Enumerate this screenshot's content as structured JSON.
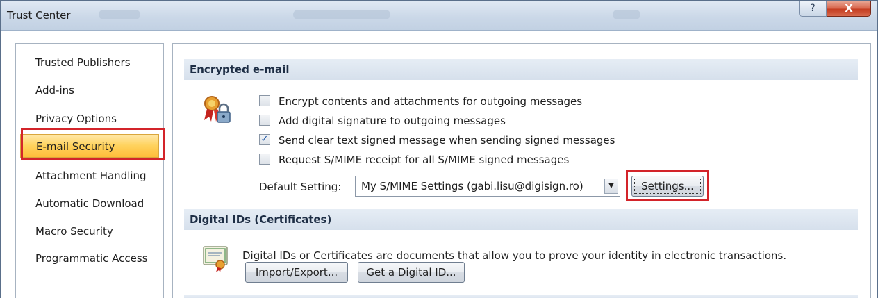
{
  "window": {
    "title": "Trust Center",
    "help_label": "?",
    "close_label": "X"
  },
  "sidebar": {
    "items": [
      {
        "label": "Trusted Publishers"
      },
      {
        "label": "Add-ins"
      },
      {
        "label": "Privacy Options"
      },
      {
        "label": "E-mail Security",
        "selected": true
      },
      {
        "label": "Attachment Handling"
      },
      {
        "label": "Automatic Download"
      },
      {
        "label": "Macro Security"
      },
      {
        "label": "Programmatic Access"
      }
    ]
  },
  "encrypted_email": {
    "header": "Encrypted e-mail",
    "icon": "certificate-lock-icon",
    "options": [
      {
        "label": "Encrypt contents and attachments for outgoing messages",
        "checked": false
      },
      {
        "label": "Add digital signature to outgoing messages",
        "checked": false
      },
      {
        "label": "Send clear text signed message when sending signed messages",
        "checked": true
      },
      {
        "label": "Request S/MIME receipt for all S/MIME signed messages",
        "checked": false
      }
    ],
    "default_setting_label": "Default Setting:",
    "default_setting_value": "My S/MIME Settings (gabi.lisu@digisign.ro)",
    "settings_button": "Settings..."
  },
  "digital_ids": {
    "header": "Digital IDs (Certificates)",
    "icon": "certificate-document-icon",
    "description": "Digital IDs or Certificates are documents that allow you to prove your identity in electronic transactions.",
    "import_export_button": "Import/Export...",
    "get_id_button": "Get a Digital ID..."
  },
  "colors": {
    "highlight_red": "#d3242a",
    "selected_item": "#ffd25c",
    "section_header": "#dde6f0"
  }
}
